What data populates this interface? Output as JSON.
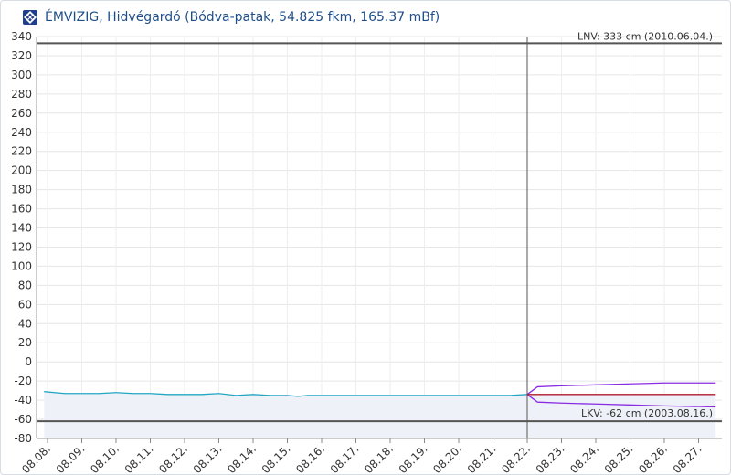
{
  "header": {
    "logo_icon": "emvizig-logo-icon",
    "title": "ÉMVIZIG, Hidvégardó (Bódva-patak, 54.825 fkm, 165.37 mBf)"
  },
  "chart_data": {
    "type": "line",
    "ylim": [
      -80,
      340
    ],
    "yticks": [
      340,
      320,
      300,
      280,
      260,
      240,
      220,
      200,
      180,
      160,
      140,
      120,
      100,
      80,
      60,
      40,
      20,
      0,
      -20,
      -40,
      -60,
      -80
    ],
    "x_categories": [
      "08.08.",
      "08.09.",
      "08.10.",
      "08.11.",
      "08.12.",
      "08.13.",
      "08.14.",
      "08.15.",
      "08.16.",
      "08.17.",
      "08.18.",
      "08.19.",
      "08.20.",
      "08.21.",
      "08.22.",
      "08.23.",
      "08.24.",
      "08.25.",
      "08.26.",
      "08.27."
    ],
    "grid": true,
    "reference_lines": [
      {
        "label": "LNV: 333 cm (2010.06.04.)",
        "value": 333
      },
      {
        "label": "LKV: -62 cm (2003.08.16.)",
        "value": -62
      }
    ],
    "current_marker_x": 14.0,
    "observed": {
      "color": "#23a6c4",
      "x": [
        -0.1,
        0.5,
        1.0,
        1.5,
        2.0,
        2.5,
        3.0,
        3.5,
        4.0,
        4.5,
        5.0,
        5.5,
        6.0,
        6.5,
        7.0,
        7.3,
        7.6,
        8.0,
        8.5,
        9.0,
        9.5,
        10.0,
        10.5,
        11.0,
        11.5,
        12.0,
        12.5,
        13.0,
        13.5,
        14.0
      ],
      "y": [
        -31,
        -33,
        -33,
        -33,
        -32,
        -33,
        -33,
        -34,
        -34,
        -34,
        -33,
        -35,
        -34,
        -35,
        -35,
        -36,
        -35,
        -35,
        -35,
        -35,
        -35,
        -35,
        -35,
        -35,
        -35,
        -35,
        -35,
        -35,
        -35,
        -34
      ]
    },
    "forecast": {
      "center": {
        "color": "#b0182c",
        "x": [
          14.0,
          14.3,
          19.5
        ],
        "y": [
          -34,
          -34,
          -34
        ]
      },
      "upper": {
        "color": "#8a2be2",
        "x": [
          14.0,
          14.3,
          15.0,
          16.0,
          17.0,
          18.0,
          19.5
        ],
        "y": [
          -34,
          -26,
          -25,
          -24,
          -23,
          -22,
          -22
        ]
      },
      "lower": {
        "color": "#8a2be2",
        "x": [
          14.0,
          14.3,
          15.0,
          16.0,
          17.0,
          18.0,
          19.5
        ],
        "y": [
          -34,
          -42,
          -43,
          -44,
          -45,
          -46,
          -47
        ]
      }
    }
  }
}
